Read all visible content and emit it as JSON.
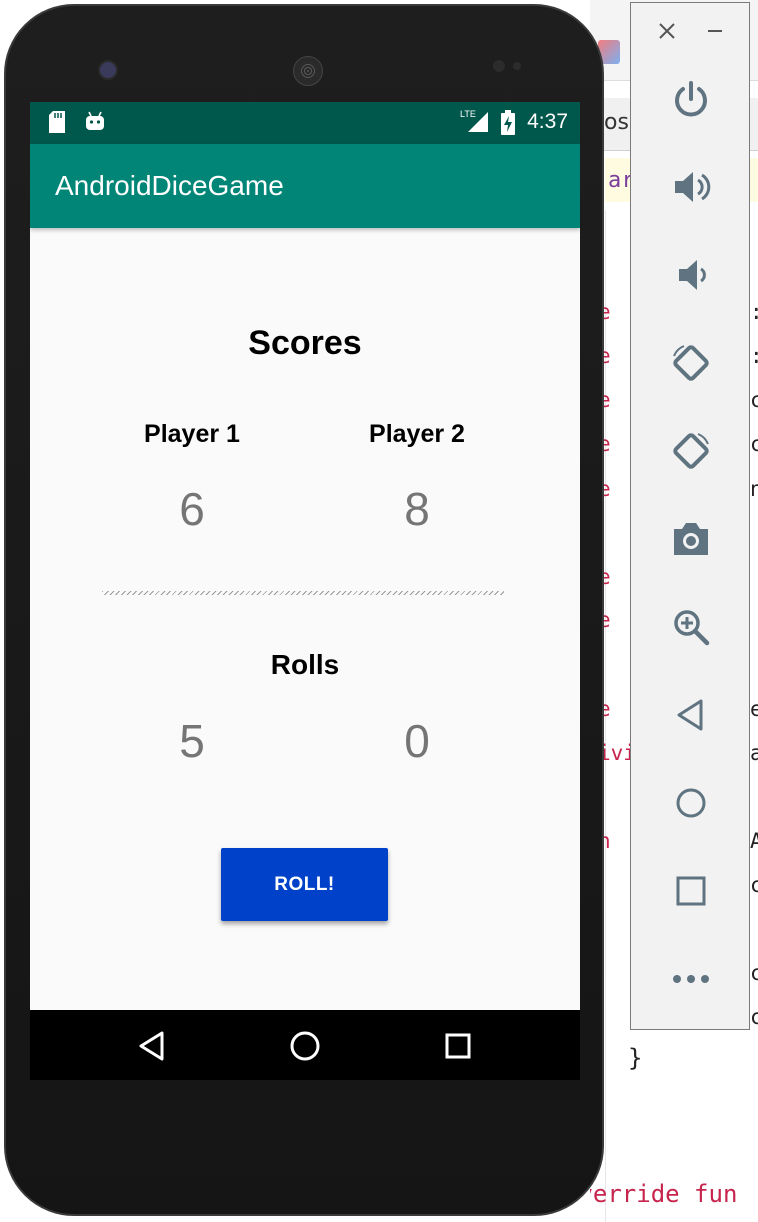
{
  "ide": {
    "tab_text": "os",
    "highlight_text": "ar",
    "code_fragments": [
      "e",
      "e",
      "e",
      "e",
      "e",
      "e",
      "e",
      "e",
      "ivi",
      "n"
    ],
    "right_fragments": [
      ":",
      ":",
      "c",
      "c",
      "n",
      "e",
      "a",
      "A",
      "c",
      "c",
      "c"
    ],
    "closing_brace": "}",
    "override_line": "override fun"
  },
  "emulator_toolbar": {
    "icons": [
      "close-icon",
      "minimize-icon",
      "power-icon",
      "volume-up-icon",
      "volume-down-icon",
      "rotate-left-icon",
      "rotate-right-icon",
      "camera-icon",
      "zoom-icon",
      "back-icon",
      "home-icon",
      "overview-icon",
      "more-icon"
    ]
  },
  "status_bar": {
    "time": "4:37",
    "network": "LTE"
  },
  "app_bar": {
    "title": "AndroidDiceGame"
  },
  "scores": {
    "title": "Scores",
    "player1_label": "Player 1",
    "player2_label": "Player 2",
    "player1_score": "6",
    "player2_score": "8"
  },
  "rolls": {
    "title": "Rolls",
    "player1_rolls": "5",
    "player2_rolls": "0"
  },
  "roll_button": {
    "label": "ROLL!"
  },
  "colors": {
    "status_bar": "#00574b",
    "app_bar": "#008577",
    "button": "#0041c9",
    "score_text": "#757575"
  }
}
